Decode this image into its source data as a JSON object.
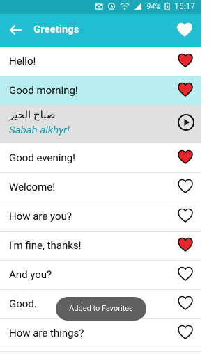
{
  "status": {
    "battery": "94%",
    "time": "15:17"
  },
  "appbar": {
    "title": "Greetings"
  },
  "items": [
    {
      "label": "Hello!",
      "favorite": true,
      "highlight": ""
    },
    {
      "label": "Good morning!",
      "favorite": true,
      "highlight": "#b9eef0"
    },
    {
      "label": "Good evening!",
      "favorite": true,
      "highlight": ""
    },
    {
      "label": "Welcome!",
      "favorite": false,
      "highlight": ""
    },
    {
      "label": "How are you?",
      "favorite": false,
      "highlight": ""
    },
    {
      "label": "I'm fine, thanks!",
      "favorite": true,
      "highlight": ""
    },
    {
      "label": "And you?",
      "favorite": false,
      "highlight": ""
    },
    {
      "label": "Good.",
      "favorite": false,
      "highlight": ""
    },
    {
      "label": "How are things?",
      "favorite": false,
      "highlight": ""
    }
  ],
  "expanded": {
    "arabic": "صباح الخير",
    "transliteration": "Sabah alkhyr!"
  },
  "toast": {
    "text": "Added to Favorites"
  },
  "colors": {
    "accent": "#20bfd2",
    "fav": "#e8262b"
  }
}
